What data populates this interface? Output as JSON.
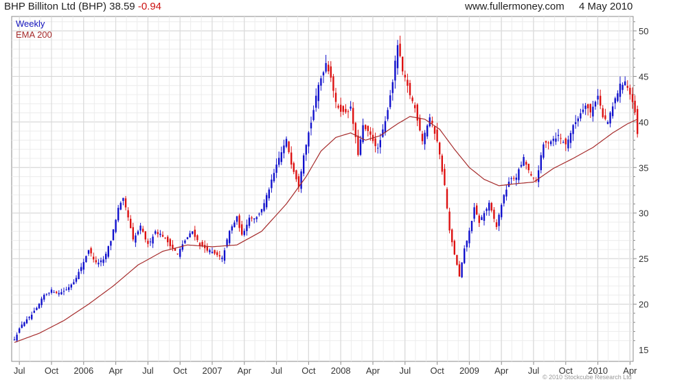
{
  "header": {
    "title": "BHP Billiton Ltd (BHP) 38.59",
    "change": "-0.94",
    "site": "www.fullermoney.com",
    "date": "4 May 2010"
  },
  "legend": {
    "weekly": "Weekly",
    "ema": "EMA 200"
  },
  "copyright": "© 2010 Stockcube Research Ltd",
  "colors": {
    "up": "#1111cc",
    "down": "#dd1111",
    "ema": "#a52a2a",
    "grid": "#dddddd"
  },
  "chart_data": {
    "type": "candlestick",
    "title": "BHP Billiton Ltd (BHP) 38.59 -0.94",
    "ylim": [
      15,
      51
    ],
    "yticks": [
      15,
      20,
      25,
      30,
      35,
      40,
      45,
      50
    ],
    "x_labels": [
      {
        "label": "Jul",
        "week": 2
      },
      {
        "label": "Oct",
        "week": 15
      },
      {
        "label": "2006",
        "week": 28
      },
      {
        "label": "Apr",
        "week": 41
      },
      {
        "label": "Jul",
        "week": 54
      },
      {
        "label": "Oct",
        "week": 67
      },
      {
        "label": "2007",
        "week": 80
      },
      {
        "label": "Apr",
        "week": 93
      },
      {
        "label": "Jul",
        "week": 106
      },
      {
        "label": "Oct",
        "week": 119
      },
      {
        "label": "2008",
        "week": 132
      },
      {
        "label": "Apr",
        "week": 145
      },
      {
        "label": "Jul",
        "week": 158
      },
      {
        "label": "Oct",
        "week": 171
      },
      {
        "label": "2009",
        "week": 184
      },
      {
        "label": "Apr",
        "week": 197
      },
      {
        "label": "Jul",
        "week": 210
      },
      {
        "label": "Oct",
        "week": 223
      },
      {
        "label": "2010",
        "week": 236
      },
      {
        "label": "Apr",
        "week": 249
      }
    ],
    "series": [
      {
        "name": "Weekly",
        "type": "candlestick",
        "anchors": [
          [
            0,
            16.2
          ],
          [
            3,
            17.8
          ],
          [
            6,
            18.5
          ],
          [
            9,
            19.5
          ],
          [
            12,
            21.0
          ],
          [
            15,
            21.5
          ],
          [
            18,
            21.2
          ],
          [
            21,
            21.6
          ],
          [
            24,
            22.5
          ],
          [
            27,
            24.0
          ],
          [
            30,
            26.0
          ],
          [
            33,
            24.5
          ],
          [
            36,
            24.8
          ],
          [
            39,
            27.0
          ],
          [
            42,
            30.5
          ],
          [
            44,
            31.5
          ],
          [
            46,
            29.5
          ],
          [
            48,
            27.0
          ],
          [
            51,
            28.5
          ],
          [
            54,
            26.5
          ],
          [
            57,
            28.0
          ],
          [
            60,
            27.5
          ],
          [
            63,
            26.5
          ],
          [
            66,
            25.5
          ],
          [
            69,
            27.0
          ],
          [
            72,
            28.0
          ],
          [
            75,
            26.5
          ],
          [
            78,
            26.0
          ],
          [
            81,
            25.5
          ],
          [
            84,
            25.0
          ],
          [
            87,
            28.0
          ],
          [
            90,
            29.5
          ],
          [
            92,
            27.5
          ],
          [
            95,
            29.5
          ],
          [
            98,
            29.5
          ],
          [
            101,
            31.0
          ],
          [
            104,
            33.5
          ],
          [
            107,
            36.0
          ],
          [
            110,
            38.0
          ],
          [
            112,
            35.5
          ],
          [
            115,
            33.0
          ],
          [
            117,
            36.5
          ],
          [
            120,
            40.0
          ],
          [
            123,
            44.0
          ],
          [
            126,
            46.5
          ],
          [
            128,
            45.0
          ],
          [
            130,
            42.0
          ],
          [
            133,
            41.0
          ],
          [
            136,
            41.5
          ],
          [
            139,
            36.5
          ],
          [
            141,
            39.5
          ],
          [
            144,
            38.5
          ],
          [
            147,
            37.0
          ],
          [
            150,
            40.0
          ],
          [
            153,
            44.5
          ],
          [
            155,
            48.5
          ],
          [
            157,
            45.5
          ],
          [
            160,
            43.0
          ],
          [
            162,
            41.5
          ],
          [
            165,
            38.0
          ],
          [
            168,
            40.5
          ],
          [
            171,
            38.0
          ],
          [
            174,
            33.0
          ],
          [
            176,
            28.0
          ],
          [
            178,
            25.5
          ],
          [
            180,
            23.0
          ],
          [
            182,
            26.0
          ],
          [
            184,
            28.0
          ],
          [
            186,
            30.5
          ],
          [
            188,
            29.0
          ],
          [
            190,
            30.0
          ],
          [
            192,
            31.0
          ],
          [
            195,
            28.5
          ],
          [
            197,
            31.0
          ],
          [
            200,
            33.5
          ],
          [
            203,
            34.0
          ],
          [
            206,
            36.0
          ],
          [
            209,
            34.0
          ],
          [
            211,
            33.5
          ],
          [
            214,
            37.5
          ],
          [
            217,
            38.0
          ],
          [
            220,
            38.5
          ],
          [
            223,
            37.5
          ],
          [
            226,
            39.5
          ],
          [
            228,
            40.5
          ],
          [
            231,
            42.0
          ],
          [
            233,
            41.0
          ],
          [
            236,
            43.0
          ],
          [
            238,
            40.5
          ],
          [
            240,
            40.0
          ],
          [
            243,
            42.5
          ],
          [
            245,
            44.0
          ],
          [
            247,
            44.5
          ],
          [
            249,
            43.0
          ],
          [
            251,
            41.0
          ],
          [
            252,
            38.6
          ]
        ],
        "ema": [
          [
            0,
            15.8
          ],
          [
            10,
            16.8
          ],
          [
            20,
            18.2
          ],
          [
            30,
            20.0
          ],
          [
            40,
            22.0
          ],
          [
            50,
            24.3
          ],
          [
            60,
            25.8
          ],
          [
            70,
            26.5
          ],
          [
            80,
            26.3
          ],
          [
            90,
            26.5
          ],
          [
            100,
            28.0
          ],
          [
            110,
            31.0
          ],
          [
            118,
            34.0
          ],
          [
            124,
            36.8
          ],
          [
            130,
            38.3
          ],
          [
            136,
            38.8
          ],
          [
            142,
            38.0
          ],
          [
            148,
            38.5
          ],
          [
            155,
            39.8
          ],
          [
            160,
            40.6
          ],
          [
            166,
            40.3
          ],
          [
            172,
            39.2
          ],
          [
            178,
            37.0
          ],
          [
            184,
            35.0
          ],
          [
            190,
            33.7
          ],
          [
            196,
            33.0
          ],
          [
            202,
            33.2
          ],
          [
            210,
            33.4
          ],
          [
            218,
            34.9
          ],
          [
            226,
            36.0
          ],
          [
            234,
            37.2
          ],
          [
            242,
            38.8
          ],
          [
            248,
            39.8
          ],
          [
            252,
            40.3
          ]
        ]
      },
      {
        "name": "EMA 200",
        "type": "line"
      }
    ]
  }
}
